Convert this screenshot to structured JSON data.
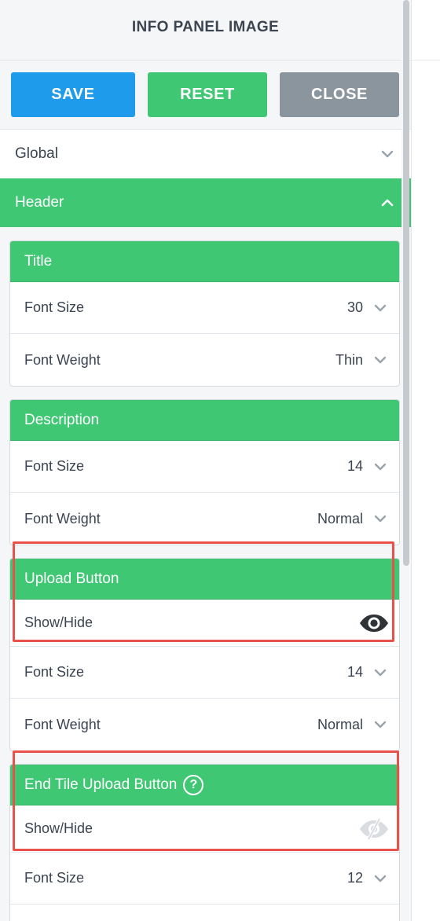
{
  "panel": {
    "title": "INFO PANEL IMAGE",
    "buttons": {
      "save": "SAVE",
      "reset": "RESET",
      "close": "CLOSE"
    },
    "accordions": {
      "global": "Global",
      "header": "Header"
    }
  },
  "sections": {
    "title": {
      "heading": "Title",
      "font_size_label": "Font Size",
      "font_size_value": "30",
      "font_weight_label": "Font Weight",
      "font_weight_value": "Thin"
    },
    "description": {
      "heading": "Description",
      "font_size_label": "Font Size",
      "font_size_value": "14",
      "font_weight_label": "Font Weight",
      "font_weight_value": "Normal"
    },
    "upload_button": {
      "heading": "Upload Button",
      "show_hide_label": "Show/Hide",
      "font_size_label": "Font Size",
      "font_size_value": "14",
      "font_weight_label": "Font Weight",
      "font_weight_value": "Normal"
    },
    "end_tile_upload_button": {
      "heading": "End Tile Upload Button",
      "help_glyph": "?",
      "show_hide_label": "Show/Hide",
      "font_size_label": "Font Size",
      "font_size_value": "12"
    }
  },
  "icons": {
    "chevron": "chevron-down-icon",
    "visible": "eye-icon",
    "hidden": "eye-off-icon",
    "help": "help-circle-icon"
  },
  "colors": {
    "green": "#40c774",
    "blue": "#1e9bea",
    "gray": "#8b959e",
    "highlight": "#e8524a"
  }
}
